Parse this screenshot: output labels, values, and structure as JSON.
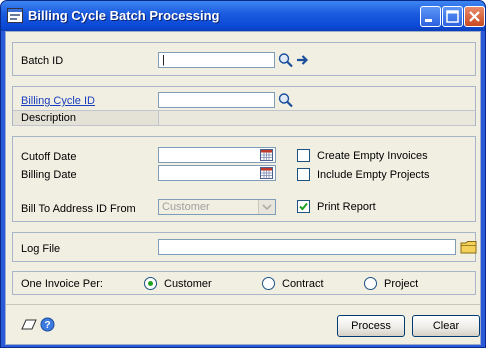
{
  "window": {
    "title": "Billing Cycle Batch Processing"
  },
  "batch": {
    "label": "Batch ID",
    "value": "|"
  },
  "billing_cycle": {
    "label": "Billing Cycle ID",
    "value": ""
  },
  "description": {
    "label": "Description",
    "value": ""
  },
  "dates": {
    "cutoff_label": "Cutoff Date",
    "cutoff_value": "",
    "billing_label": "Billing Date",
    "billing_value": ""
  },
  "options": {
    "create_empty_invoices": {
      "label": "Create Empty Invoices",
      "checked": false
    },
    "include_empty_projects": {
      "label": "Include Empty Projects",
      "checked": false
    },
    "print_report": {
      "label": "Print Report",
      "checked": true
    }
  },
  "bill_to": {
    "label": "Bill To Address ID From",
    "selected": "Customer"
  },
  "log_file": {
    "label": "Log File",
    "value": ""
  },
  "invoice_per": {
    "label": "One Invoice Per:",
    "options": [
      "Customer",
      "Contract",
      "Project"
    ],
    "selected": "Customer"
  },
  "buttons": {
    "process": "Process",
    "clear": "Clear"
  },
  "colors": {
    "titlebar": "#0a48d6",
    "client": "#f1efe2",
    "link": "#1a3dbd",
    "check": "#21a121"
  }
}
